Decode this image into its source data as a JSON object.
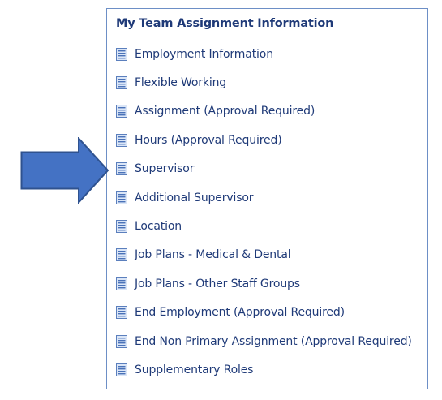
{
  "panel": {
    "title": "My Team Assignment Information",
    "items": [
      {
        "label": "Employment Information",
        "icon": "document-icon"
      },
      {
        "label": "Flexible Working",
        "icon": "document-icon"
      },
      {
        "label": "Assignment (Approval Required)",
        "icon": "document-icon"
      },
      {
        "label": "Hours (Approval Required)",
        "icon": "document-icon"
      },
      {
        "label": "Supervisor",
        "icon": "document-icon"
      },
      {
        "label": "Additional Supervisor",
        "icon": "document-icon"
      },
      {
        "label": "Location",
        "icon": "document-icon"
      },
      {
        "label": "Job Plans - Medical & Dental",
        "icon": "document-icon"
      },
      {
        "label": "Job Plans - Other Staff Groups",
        "icon": "document-icon"
      },
      {
        "label": "End Employment (Approval Required)",
        "icon": "document-icon"
      },
      {
        "label": "End Non Primary Assignment (Approval Required)",
        "icon": "document-icon"
      },
      {
        "label": "Supplementary Roles",
        "icon": "document-icon"
      }
    ]
  },
  "colors": {
    "link_text": "#1f3a78",
    "panel_border": "#6d8fc6",
    "arrow_fill": "#4472c4",
    "arrow_stroke": "#2f528f"
  }
}
